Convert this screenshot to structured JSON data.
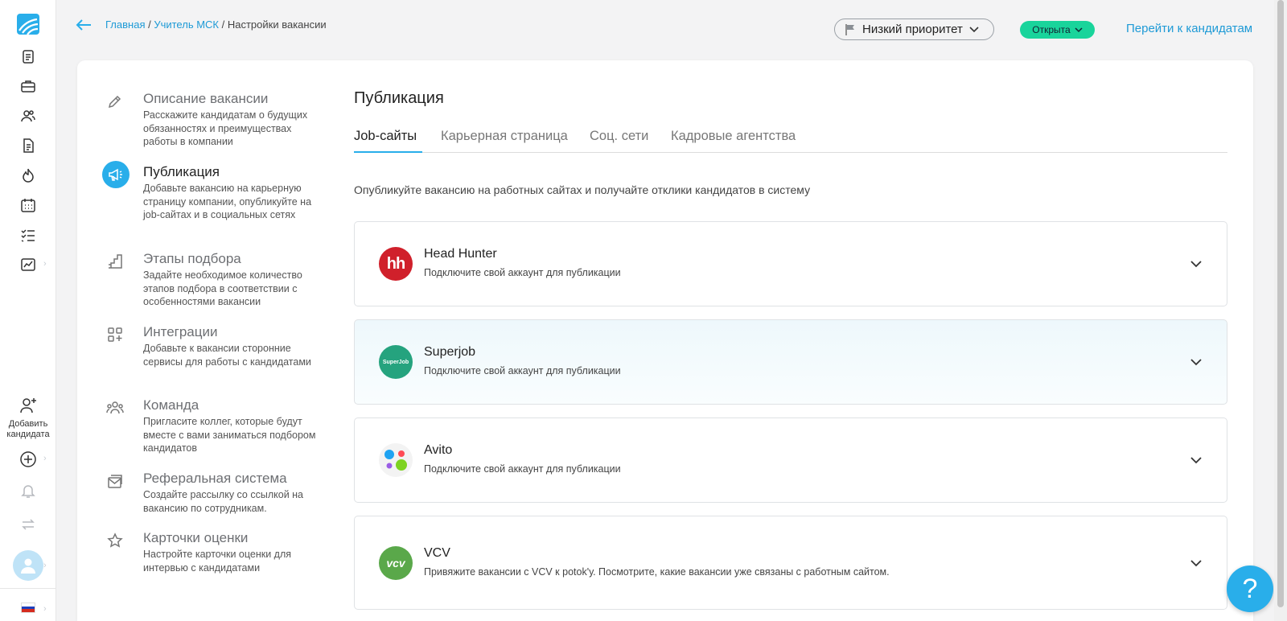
{
  "breadcrumbs": {
    "home": "Главная",
    "sep1": " / ",
    "vacancy": "Учитель МСК",
    "sep2": " / ",
    "current": "Настройки вакансии"
  },
  "header": {
    "priority_label": "Низкий приоритет",
    "status_label": "Открыта",
    "goto_candidates": "Перейти к кандидатам"
  },
  "rail": {
    "add_candidate_line1": "Добавить",
    "add_candidate_line2": "кандидата"
  },
  "steps": [
    {
      "title": "Описание вакансии",
      "desc": "Расскажите кандидатам о будущих обязанностях и преимуществах работы в компании",
      "icon": "pencil-icon"
    },
    {
      "title": "Публикация",
      "desc": "Добавьте вакансию на карьерную страницу компании, опубликуйте на job-сайтах и в социальных сетях",
      "icon": "megaphone-icon"
    },
    {
      "title": "Этапы подбора",
      "desc": "Задайте необходимое количество этапов подбора в соответствии с особенностями вакансии",
      "icon": "stairs-icon"
    },
    {
      "title": "Интеграции",
      "desc": "Добавьте к вакансии сторонние сервисы для работы с кандидатами",
      "icon": "grid-plus-icon"
    },
    {
      "title": "Команда",
      "desc": "Пригласите коллег, которые будут вместе с вами заниматься подбором кандидатов",
      "icon": "team-icon"
    },
    {
      "title": "Реферальная система",
      "desc": "Создайте рассылку со ссылкой на вакансию по сотрудникам.",
      "icon": "mail-icon"
    },
    {
      "title": "Карточки оценки",
      "desc": "Настройте карточки оценки для интервью с кандидатами",
      "icon": "star-icon"
    }
  ],
  "publication": {
    "title": "Публикация",
    "tabs": [
      "Job-сайты",
      "Карьерная страница",
      "Соц. сети",
      "Кадровые агентства"
    ],
    "intro": "Опубликуйте вакансию на работных сайтах и получайте отклики кандидатов в систему",
    "sites": [
      {
        "name": "Head Hunter",
        "sub": "Подключите свой аккаунт для публикации",
        "logo_text": "hh"
      },
      {
        "name": "Superjob",
        "sub": "Подключите свой аккаунт для публикации",
        "logo_text": "SuperJob"
      },
      {
        "name": "Avito",
        "sub": "Подключите свой аккаунт для публикации",
        "logo_text": ""
      },
      {
        "name": "VCV",
        "sub": "Привяжите вакансии с VCV к potok'у. Посмотрите, какие вакансии уже связаны с работным сайтом.",
        "logo_text": "vcv"
      }
    ]
  },
  "help_label": "?",
  "colors": {
    "accent": "#29aeea",
    "link": "#1e9ad6",
    "status": "#19d49b",
    "hh": "#d0202b",
    "superjob": "#25a37e",
    "vcv": "#5aa84a"
  }
}
